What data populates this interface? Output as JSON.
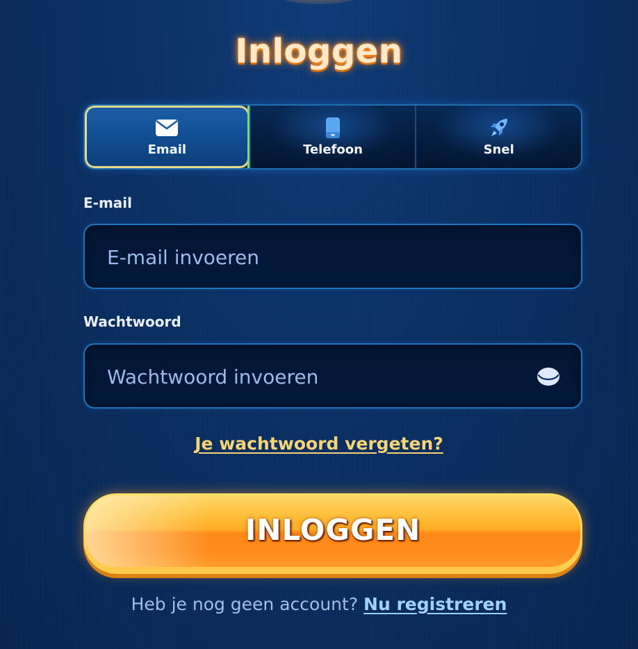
{
  "title": "Inloggen",
  "tabs": [
    {
      "label": "Email",
      "icon": "envelope-icon",
      "active": true
    },
    {
      "label": "Telefoon",
      "icon": "phone-icon",
      "active": false
    },
    {
      "label": "Snel",
      "icon": "rocket-icon",
      "active": false
    }
  ],
  "email": {
    "label": "E-mail",
    "placeholder": "E-mail invoeren",
    "value": ""
  },
  "password": {
    "label": "Wachtwoord",
    "placeholder": "Wachtwoord invoeren",
    "value": "",
    "toggle_icon": "eye-icon"
  },
  "forgot_link": "Je wachtwoord vergeten?",
  "login_button": "INLOGGEN",
  "register": {
    "prompt": "Heb je nog geen account?",
    "link": "Nu registreren"
  },
  "colors": {
    "background": "#0a2f63",
    "title_glow": "#ff8a1e",
    "link_gold": "#f7d474",
    "button_orange": "#ff8a1a",
    "input_border": "#1f74bf",
    "register_link": "#9fd3ff"
  }
}
